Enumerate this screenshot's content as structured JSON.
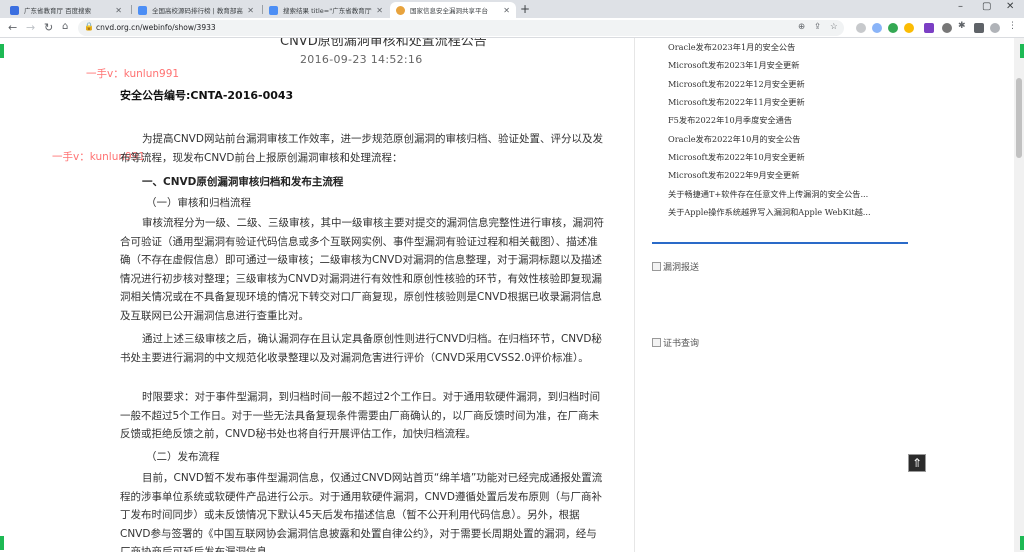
{
  "browser": {
    "tabs": [
      {
        "title": "广东省教育厅 百度搜索",
        "fav_color": "#3b6fe0",
        "active": false
      },
      {
        "title": "全国高校源码排行榜 | 教育部高校",
        "fav_color": "#4c8ef5",
        "active": false
      },
      {
        "title": "搜索结果 title=\"广东省教育厅\" ...",
        "fav_color": "#4c8ef5",
        "active": false
      },
      {
        "title": "国家信息安全漏洞共享平台",
        "fav_color": "#e8a33d",
        "active": true
      }
    ],
    "new_tab": "+",
    "url": "cnvd.org.cn/webinfo/show/3933",
    "window": {
      "min": "–",
      "max": "▢",
      "close": "✕"
    }
  },
  "article": {
    "title_partial": "CNVD原创漏洞审核和处置流程公告",
    "date": "2016-09-23 14:52:16",
    "notice_no": "安全公告编号:CNTA-2016-0043",
    "watermark": "一手v：kunlun991",
    "watermark2": "一手v：kunlun991",
    "para1": "为提高CNVD网站前台漏洞审核工作效率，进一步规范原创漏洞的审核归档、验证处置、评分以及发布等流程，现发布CNVD前台上报原创漏洞审核和处理流程：",
    "h1": "一、CNVD原创漏洞审核归档和发布主流程",
    "h2a": "（一）审核和归档流程",
    "para2": "审核流程分为一级、二级、三级审核，其中一级审核主要对提交的漏洞信息完整性进行审核，漏洞符合可验证（通用型漏洞有验证代码信息或多个互联网实例、事件型漏洞有验证过程和相关截图）、描述准确（不存在虚假信息）即可通过一级审核；二级审核为CNVD对漏洞的信息整理，对于漏洞标题以及描述情况进行初步核对整理；三级审核为CNVD对漏洞进行有效性和原创性核验的环节，有效性核验即复现漏洞相关情况或在不具备复现环境的情况下转交对口厂商复现，原创性核验则是CNVD根据已收录漏洞信息及互联网已公开漏洞信息进行查重比对。",
    "para3": "通过上述三级审核之后，确认漏洞存在且认定具备原创性则进行CNVD归档。在归档环节，CNVD秘书处主要进行漏洞的中文规范化收录整理以及对漏洞危害进行评价（CNVD采用CVSS2.0评价标准）。",
    "para4": "时限要求：对于事件型漏洞，到归档时间一般不超过2个工作日。对于通用软硬件漏洞，到归档时间一般不超过5个工作日。对于一些无法具备复现条件需要由厂商确认的，以厂商反馈时间为准，在厂商未反馈或拒绝反馈之前，CNVD秘书处也将自行开展评估工作，加快归档流程。",
    "h2b": "（二）发布流程",
    "para5": "目前，CNVD暂不发布事件型漏洞信息，仅通过CNVD网站首页“绵羊墙”功能对已经完成通报处置流程的涉事单位系统或软硬件产品进行公示。对于通用软硬件漏洞，CNVD遵循处置后发布原则（与厂商补丁发布时间同步）或未反馈情况下默认45天后发布描述信息（暂不公开利用代码信息）。另外，根据CNVD参与签署的《中国互联网协会漏洞信息披露和处置自律公约》，对于需要长周期处置的漏洞，经与厂商协商后可延后发布漏洞信息。"
  },
  "sidebar": {
    "links": [
      "Oracle发布2023年1月的安全公告",
      "Microsoft发布2023年1月安全更新",
      "Microsoft发布2022年12月安全更新",
      "Microsoft发布2022年11月安全更新",
      "F5发布2022年10月季度安全通告",
      "Oracle发布2022年10月的安全公告",
      "Microsoft发布2022年10月安全更新",
      "Microsoft发布2022年9月安全更新",
      "关于畅捷通T+软件存在任意文件上传漏洞的安全公告...",
      "关于Apple操作系统越界写入漏洞和Apple WebKit越..."
    ],
    "img1_alt": "漏洞报送",
    "img2_alt": "证书查询",
    "back_to_top": "⇑"
  }
}
